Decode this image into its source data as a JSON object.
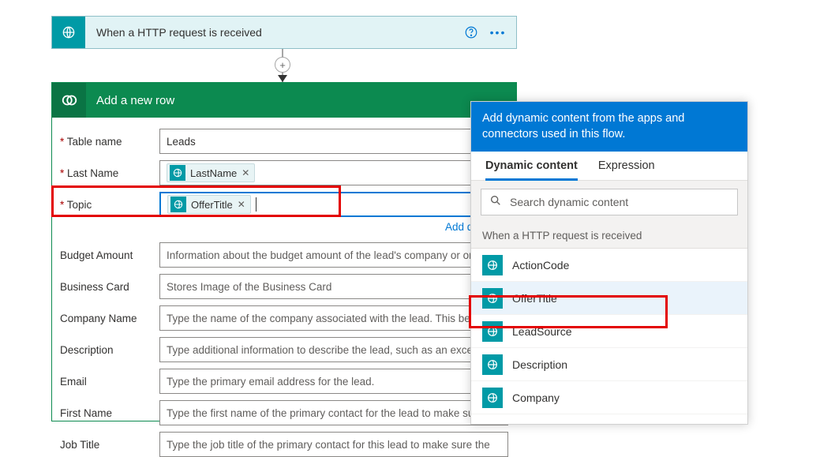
{
  "trigger": {
    "title": "When a HTTP request is received"
  },
  "action": {
    "title": "Add a new row",
    "add_dynamic_link": "Add dynamic"
  },
  "fields": {
    "table_name": {
      "label": "Table name",
      "value": "Leads"
    },
    "last_name": {
      "label": "Last Name",
      "pill": "LastName"
    },
    "topic": {
      "label": "Topic",
      "pill": "OfferTitle"
    },
    "budget_amount": {
      "label": "Budget Amount",
      "placeholder": "Information about the budget amount of the lead's company or organ"
    },
    "business_card": {
      "label": "Business Card",
      "placeholder": "Stores Image of the Business Card"
    },
    "company_name": {
      "label": "Company Name",
      "placeholder": "Type the name of the company associated with the lead. This become"
    },
    "description": {
      "label": "Description",
      "placeholder": "Type additional information to describe the lead, such as an excerpt fr"
    },
    "email": {
      "label": "Email",
      "placeholder": "Type the primary email address for the lead."
    },
    "first_name": {
      "label": "First Name",
      "placeholder": "Type the first name of the primary contact for the lead to make sure th"
    },
    "job_title": {
      "label": "Job Title",
      "placeholder": "Type the job title of the primary contact for this lead to make sure the"
    }
  },
  "panel": {
    "header": "Add dynamic content from the apps and connectors used in this flow.",
    "tabs": {
      "dynamic": "Dynamic content",
      "expression": "Expression"
    },
    "search_placeholder": "Search dynamic content",
    "section": "When a HTTP request is received",
    "items": [
      "ActionCode",
      "OfferTitle",
      "LeadSource",
      "Description",
      "Company"
    ]
  }
}
